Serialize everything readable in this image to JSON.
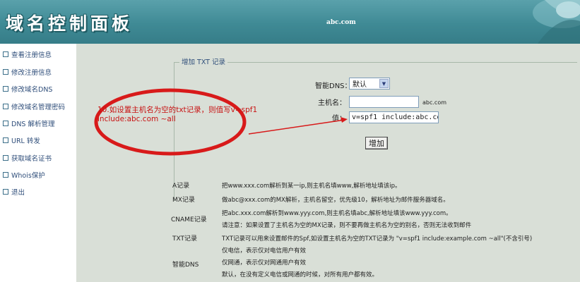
{
  "header": {
    "title": "域名控制面板",
    "domain": "abc.com"
  },
  "sidebar": {
    "items": [
      {
        "label": "查看注册信息"
      },
      {
        "label": "修改注册信息"
      },
      {
        "label": "修改域名DNS"
      },
      {
        "label": "修改域名管理密码"
      },
      {
        "label": "DNS 解析管理"
      },
      {
        "label": "URL 转发"
      },
      {
        "label": "获取域名证书"
      },
      {
        "label": "Whois保护"
      },
      {
        "label": "退出"
      }
    ]
  },
  "form": {
    "legend": "增加 TXT 记录",
    "smart_dns_label": "智能DNS：",
    "smart_dns_value": "默认",
    "host_label": "主机名：",
    "host_value": "",
    "host_suffix": "abc.com",
    "value_label": "值：",
    "value_value": "v=spf1 include:abc.co",
    "submit_label": "增加"
  },
  "annotation": {
    "text": "10.如设置主机名为空的txt记录，则值写v=spf1 include:abc.com ~all",
    "color": "#c81414"
  },
  "info": {
    "a_label": "A记录",
    "a_text": "把www.xxx.com解析到某一ip,则主机名填www,解析地址填该ip。",
    "mx_label": "MX记录",
    "mx_text": "做abc@xxx.com的MX解析，主机名留空，优先级10，解析地址为邮件服务器域名。",
    "cname_label": "CNAME记录",
    "cname_text1": "把abc.xxx.com解析到www.yyy.com,则主机名填abc,解析地址填该www.yyy.com。",
    "cname_text2": "请注意：如果设置了主机名为空的MX记录，则不要再做主机名为空的别名，否则无法收到邮件",
    "txt_label": "TXT记录",
    "txt_text": "TXT记录可以用来设置邮件的Spf,如设置主机名为空的TXT记录为 \"v=spf1 include:example.com ~all\"(不含引号)",
    "smart_label": "智能DNS",
    "smart_text1": "仅电信，表示仅对电信用户有效",
    "smart_text2": "仅网通，表示仅对网通用户有效",
    "smart_text3": "默认，在没有定义电信或网通的时候，对所有用户都有效。"
  },
  "colors": {
    "header": "#3f8a95",
    "background": "#d9dfd7",
    "annotation": "#c81414",
    "link": "#2f4e7a"
  }
}
